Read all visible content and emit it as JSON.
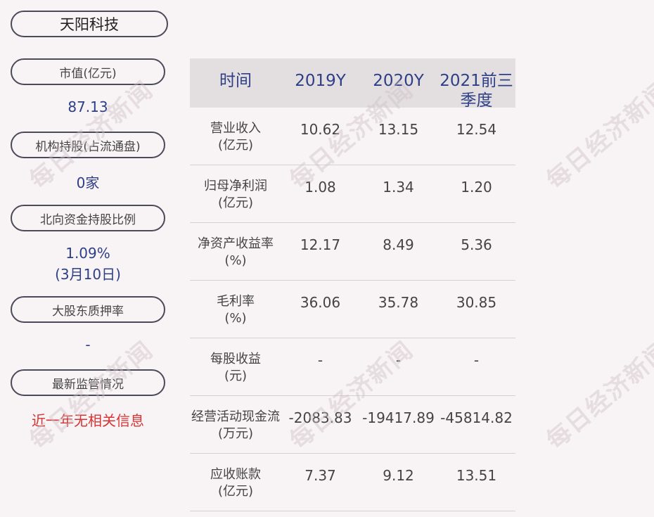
{
  "company": "天阳科技",
  "sidebar": {
    "market_cap_label": "市值(亿元)",
    "market_cap_value": "87.13",
    "institution_label": "机构持股(占流通盘)",
    "institution_value": "0家",
    "northbound_label": "北向资金持股比例",
    "northbound_value": "1.09%",
    "northbound_date": "(3月10日)",
    "pledge_label": "大股东质押率",
    "pledge_value": "-",
    "regulation_label": "最新监管情况",
    "regulation_value": "近一年无相关信息"
  },
  "table": {
    "headers": [
      "时间",
      "2019Y",
      "2020Y",
      "2021前三季度"
    ],
    "rows": [
      {
        "label": "营业收入",
        "unit": "(亿元)",
        "values": [
          "10.62",
          "13.15",
          "12.54"
        ]
      },
      {
        "label": "归母净利润",
        "unit": "(亿元)",
        "values": [
          "1.08",
          "1.34",
          "1.20"
        ]
      },
      {
        "label": "净资产收益率",
        "unit": "(%)",
        "values": [
          "12.17",
          "8.49",
          "5.36"
        ]
      },
      {
        "label": "毛利率",
        "unit": "(%)",
        "values": [
          "36.06",
          "35.78",
          "30.85"
        ]
      },
      {
        "label": "每股收益",
        "unit": "(元)",
        "values": [
          "-",
          "-",
          "-"
        ]
      },
      {
        "label": "经营活动现金流",
        "unit": "(万元)",
        "values": [
          "-2083.83",
          "-19417.89",
          "-45814.82"
        ]
      },
      {
        "label": "应收账款",
        "unit": "(亿元)",
        "values": [
          "7.37",
          "9.12",
          "13.51"
        ]
      }
    ]
  },
  "watermark": "每日经济新闻",
  "colors": {
    "accent": "#2e3f87",
    "alert": "#d63333",
    "header_bg": "#e3dfe0",
    "background": "#f8f3f4"
  }
}
